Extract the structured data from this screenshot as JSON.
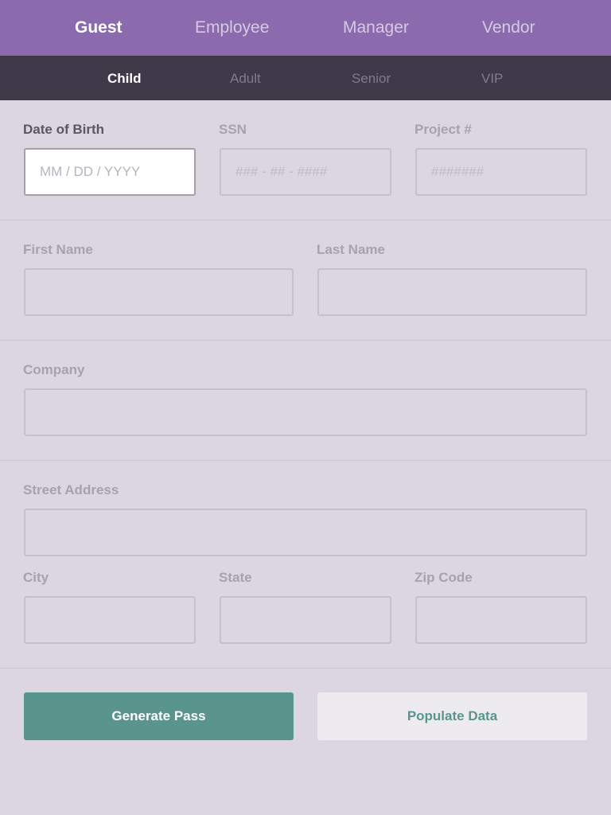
{
  "entrant_types": [
    {
      "label": "Guest",
      "active": true
    },
    {
      "label": "Employee",
      "active": false
    },
    {
      "label": "Manager",
      "active": false
    },
    {
      "label": "Vendor",
      "active": false
    }
  ],
  "sub_types": [
    {
      "label": "Child",
      "active": true
    },
    {
      "label": "Adult",
      "active": false
    },
    {
      "label": "Senior",
      "active": false
    },
    {
      "label": "VIP",
      "active": false
    }
  ],
  "form": {
    "dob": {
      "label": "Date of Birth",
      "placeholder": "MM / DD / YYYY",
      "value": ""
    },
    "ssn": {
      "label": "SSN",
      "placeholder": "### - ## - ####",
      "value": ""
    },
    "project": {
      "label": "Project #",
      "placeholder": "#######",
      "value": ""
    },
    "first_name": {
      "label": "First Name",
      "placeholder": "",
      "value": ""
    },
    "last_name": {
      "label": "Last Name",
      "placeholder": "",
      "value": ""
    },
    "company": {
      "label": "Company",
      "placeholder": "",
      "value": ""
    },
    "street": {
      "label": "Street Address",
      "placeholder": "",
      "value": ""
    },
    "city": {
      "label": "City",
      "placeholder": "",
      "value": ""
    },
    "state": {
      "label": "State",
      "placeholder": "",
      "value": ""
    },
    "zip": {
      "label": "Zip Code",
      "placeholder": "",
      "value": ""
    }
  },
  "actions": {
    "generate_label": "Generate Pass",
    "populate_label": "Populate Data"
  },
  "colors": {
    "top_bar": "#8b6bad",
    "sub_bar": "#3f3848",
    "background": "#dbd6df",
    "primary_button": "#59958d",
    "secondary_button": "#eeebf0"
  }
}
